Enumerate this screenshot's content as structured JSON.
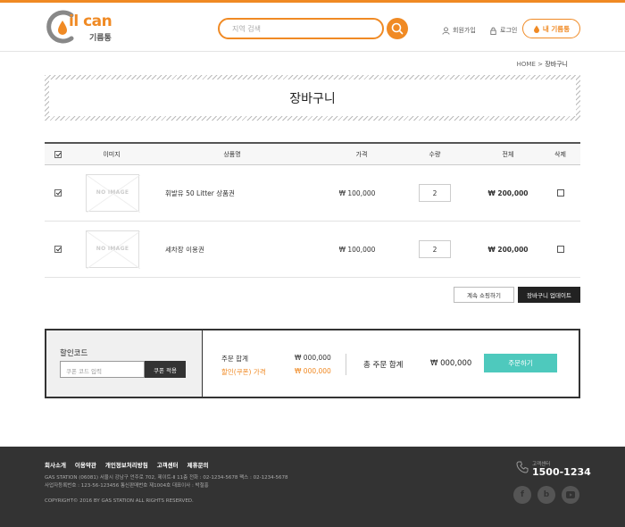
{
  "brand": {
    "logo_text": "il can",
    "logo_sub": "기름통",
    "color": "#f08a24"
  },
  "header": {
    "search_placeholder": "지역 검색",
    "signup": "회원가입",
    "login": "로그인",
    "my_tank": "내 기름통"
  },
  "breadcrumb": {
    "home": "HOME",
    "sep": ">",
    "current": "장바구니"
  },
  "page_title": "장바구니",
  "table": {
    "headers": {
      "image": "이미지",
      "product": "상품명",
      "price": "가격",
      "qty": "수량",
      "total": "전체",
      "delete": "삭제"
    },
    "rows": [
      {
        "checked": true,
        "noimage": "NO IMAGE",
        "name": "휘발유 50 Litter 상품권",
        "price": "₩ 100,000",
        "qty": "2",
        "total": "₩ 200,000"
      },
      {
        "checked": true,
        "noimage": "NO IMAGE",
        "name": "세차장 이용권",
        "price": "₩ 100,000",
        "qty": "2",
        "total": "₩ 200,000"
      }
    ]
  },
  "actions": {
    "continue": "계속 쇼핑하기",
    "update": "장바구니 업데이트"
  },
  "coupon": {
    "title": "할인코드",
    "placeholder": "쿠폰 코드 입력",
    "apply": "쿠폰 적용"
  },
  "summary": {
    "order_total_label": "주문 합계",
    "order_total_value": "₩ 000,000",
    "discount_label": "할인(쿠폰) 가격",
    "discount_value": "₩ 000,000",
    "grand_label": "총 주문 합계",
    "grand_value": "₩ 000,000",
    "order_button": "주문하기",
    "accent": "#4ec9bd"
  },
  "footer": {
    "links": [
      "회사소개",
      "이용약관",
      "개인정보처리방침",
      "고객센터",
      "제휴문의"
    ],
    "address": "GAS STATION (06081) 서울시 강남구 언주로 702, 제이트-Ⅱ 11층   전화 : 02-1234-5678   팩스 : 02-1234-5678",
    "business": "사업자등록번호 : 123-56-123456   통신판매번호 제1004호   대표이사 : 박철홍",
    "copyright": "COPYRIGHT© 2016 BY GAS STATION ALL RIGHTS RESERVED.",
    "cs_label": "고객센터",
    "cs_phone": "1500-1234",
    "social": [
      "facebook-icon",
      "blog-icon",
      "youtube-icon"
    ]
  }
}
